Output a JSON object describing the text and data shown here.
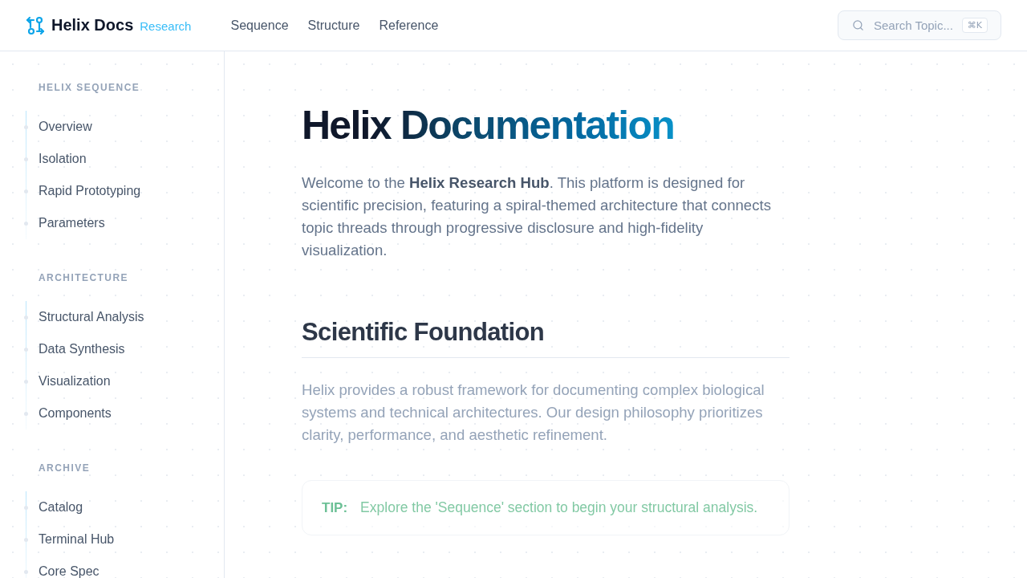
{
  "header": {
    "logo": {
      "title": "Helix Docs",
      "tag": "Research"
    },
    "nav": [
      {
        "label": "Sequence"
      },
      {
        "label": "Structure"
      },
      {
        "label": "Reference"
      }
    ],
    "search": {
      "placeholder": "Search Topic...",
      "shortcut": "⌘K"
    }
  },
  "sidebar": {
    "sections": [
      {
        "title": "HELIX SEQUENCE",
        "items": [
          {
            "label": "Overview"
          },
          {
            "label": "Isolation"
          },
          {
            "label": "Rapid Prototyping"
          },
          {
            "label": "Parameters"
          }
        ]
      },
      {
        "title": "ARCHITECTURE",
        "items": [
          {
            "label": "Structural Analysis"
          },
          {
            "label": "Data Synthesis"
          },
          {
            "label": "Visualization"
          },
          {
            "label": "Components"
          }
        ]
      },
      {
        "title": "ARCHIVE",
        "items": [
          {
            "label": "Catalog"
          },
          {
            "label": "Terminal Hub"
          },
          {
            "label": "Core Spec"
          }
        ]
      }
    ]
  },
  "article": {
    "title": "Helix Documentation",
    "intro": "Welcome to the **Helix Research Hub**. This platform is designed for scientific precision, featuring a spiral-themed architecture that connects topic threads through progressive disclosure and high-fidelity visualization.",
    "sections": [
      {
        "heading": "Scientific Foundation",
        "body": "Helix provides a robust framework for documenting complex biological systems and technical architectures. Our design philosophy prioritizes clarity, performance, and aesthetic refinement.",
        "tip": {
          "label": "TIP:",
          "text": "Explore the 'Sequence' section to begin your structural analysis."
        }
      }
    ]
  }
}
